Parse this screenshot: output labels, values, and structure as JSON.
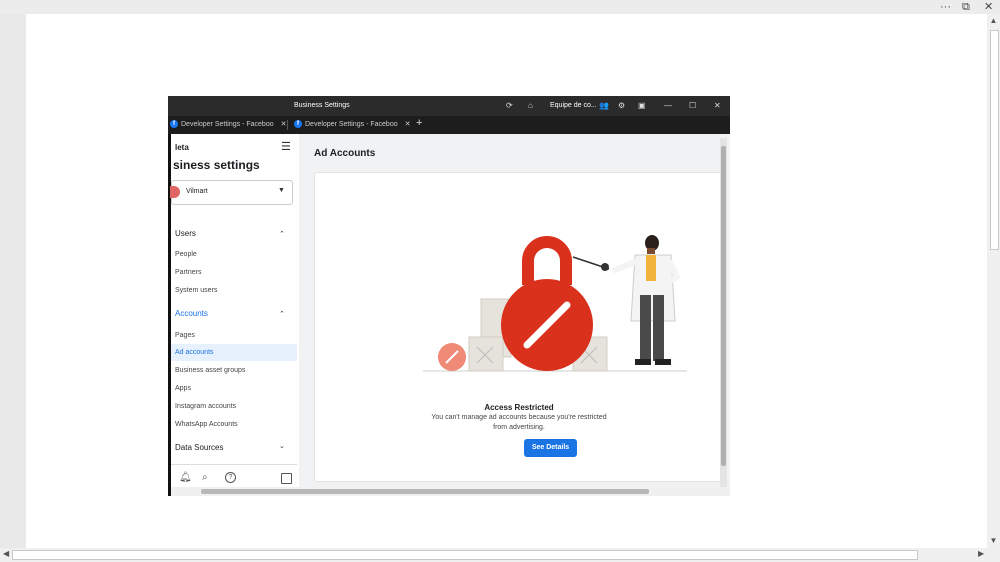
{
  "viewer": {
    "more_label": "···",
    "restore_glyph": "⧉",
    "close_glyph": "✕"
  },
  "browser": {
    "window_title": "Business Settings",
    "profile_label": "Equipe de co...",
    "tabs": [
      {
        "label": "Developer Settings - Faceboo"
      },
      {
        "label": "Developer Settings - Faceboo"
      }
    ],
    "new_tab_label": "+",
    "minimize_glyph": "—",
    "maximize_glyph": "☐",
    "close_glyph": "✕"
  },
  "sidebar": {
    "brand": "leta",
    "title": "siness settings",
    "account_name": "Vilmart",
    "sections": {
      "users": {
        "label": "Users",
        "items": [
          "People",
          "Partners",
          "System users"
        ]
      },
      "accounts": {
        "label": "Accounts",
        "items": [
          "Pages",
          "Ad accounts",
          "Business asset groups",
          "Apps",
          "Instagram accounts",
          "WhatsApp Accounts"
        ]
      },
      "data_sources": {
        "label": "Data Sources"
      }
    },
    "active_item": "Ad accounts"
  },
  "main": {
    "page_title": "Ad Accounts",
    "restricted_title": "Access Restricted",
    "restricted_line1": "You can't manage ad accounts because you're restricted",
    "restricted_line2": "from advertising.",
    "details_button": "See Details"
  },
  "colors": {
    "accent": "#1b74e4",
    "lock_red": "#d9311c",
    "active_bg": "#e7f0fd"
  }
}
